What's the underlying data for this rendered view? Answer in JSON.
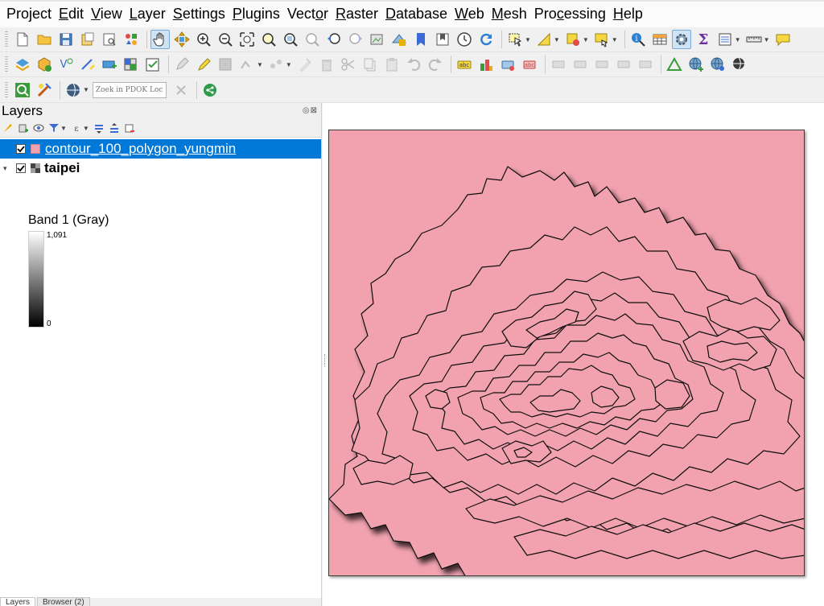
{
  "menu": {
    "items": [
      {
        "pre": "",
        "ul": "",
        "post": "Project"
      },
      {
        "pre": "",
        "ul": "E",
        "post": "dit"
      },
      {
        "pre": "",
        "ul": "V",
        "post": "iew"
      },
      {
        "pre": "",
        "ul": "L",
        "post": "ayer"
      },
      {
        "pre": "",
        "ul": "S",
        "post": "ettings"
      },
      {
        "pre": "",
        "ul": "P",
        "post": "lugins"
      },
      {
        "pre": "Vect",
        "ul": "o",
        "post": "r"
      },
      {
        "pre": "",
        "ul": "R",
        "post": "aster"
      },
      {
        "pre": "",
        "ul": "D",
        "post": "atabase"
      },
      {
        "pre": "",
        "ul": "W",
        "post": "eb"
      },
      {
        "pre": "",
        "ul": "M",
        "post": "esh"
      },
      {
        "pre": "Pro",
        "ul": "c",
        "post": "essing"
      },
      {
        "pre": "",
        "ul": "H",
        "post": "elp"
      }
    ]
  },
  "locator": {
    "placeholder": "Zoek in PDOK Loc···"
  },
  "layers_panel": {
    "title": "Layers",
    "panel_buttons": "◎⊠",
    "layers": [
      {
        "name": "contour_100_polygon_yungmin",
        "selected": true,
        "checked": true
      },
      {
        "name": "taipei",
        "selected": false,
        "checked": true
      }
    ],
    "band_label": "Band 1 (Gray)",
    "ramp_max": "1,091",
    "ramp_min": "0"
  },
  "bottom_tabs": [
    "Layers",
    "Browser (2)"
  ],
  "colors": {
    "polygon_fill": "#f2a2af",
    "selection": "#0078d7"
  }
}
